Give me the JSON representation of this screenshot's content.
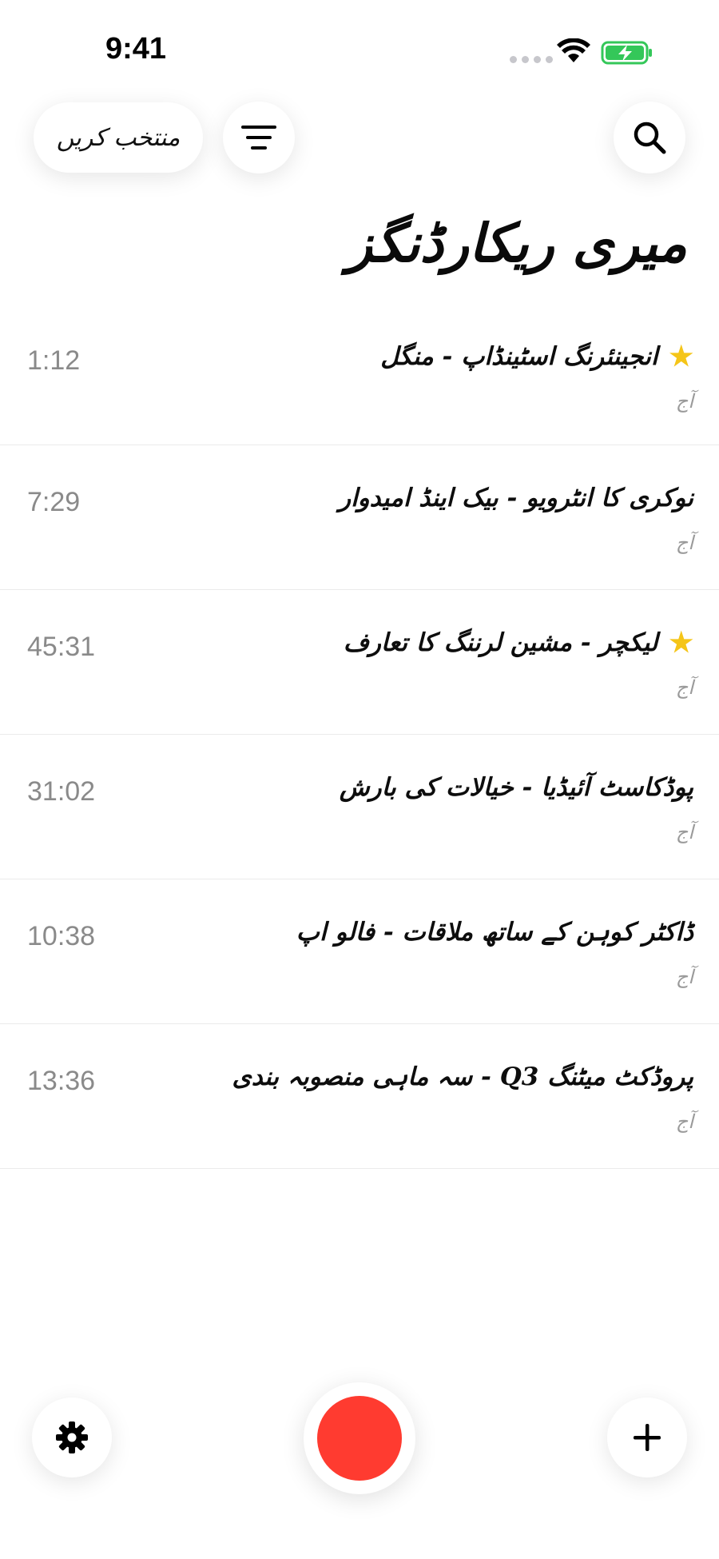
{
  "status_bar": {
    "time": "9:41"
  },
  "header": {
    "select_label": "منتخب کریں",
    "title": "میری ریکارڈنگز"
  },
  "icons": {
    "wifi": "wifi-icon",
    "battery": "battery-charging-icon",
    "filter": "filter-lines-icon",
    "search": "search-icon",
    "star": "star-icon",
    "settings": "gear-icon",
    "add": "plus-icon",
    "record": "record-icon"
  },
  "colors": {
    "record": "#ff3b30",
    "star": "#f5c518",
    "battery": "#34c759"
  },
  "recordings": [
    {
      "title": "انجینئرنگ اسٹینڈاپ - منگل",
      "date": "آج",
      "duration": "1:12",
      "starred": true
    },
    {
      "title": "نوکری کا انٹرویو - بیک اینڈ امیدوار",
      "date": "آج",
      "duration": "7:29",
      "starred": false
    },
    {
      "title": "لیکچر - مشین لرننگ کا تعارف",
      "date": "آج",
      "duration": "45:31",
      "starred": true
    },
    {
      "title": "پوڈکاسٹ آئیڈیا - خیالات کی بارش",
      "date": "آج",
      "duration": "31:02",
      "starred": false
    },
    {
      "title": "ڈاکٹر کوہن کے ساتھ ملاقات - فالو اپ",
      "date": "آج",
      "duration": "10:38",
      "starred": false
    },
    {
      "title": "پروڈکٹ میٹنگ Q3 - سہ ماہی منصوبہ بندی",
      "date": "آج",
      "duration": "13:36",
      "starred": false
    }
  ]
}
